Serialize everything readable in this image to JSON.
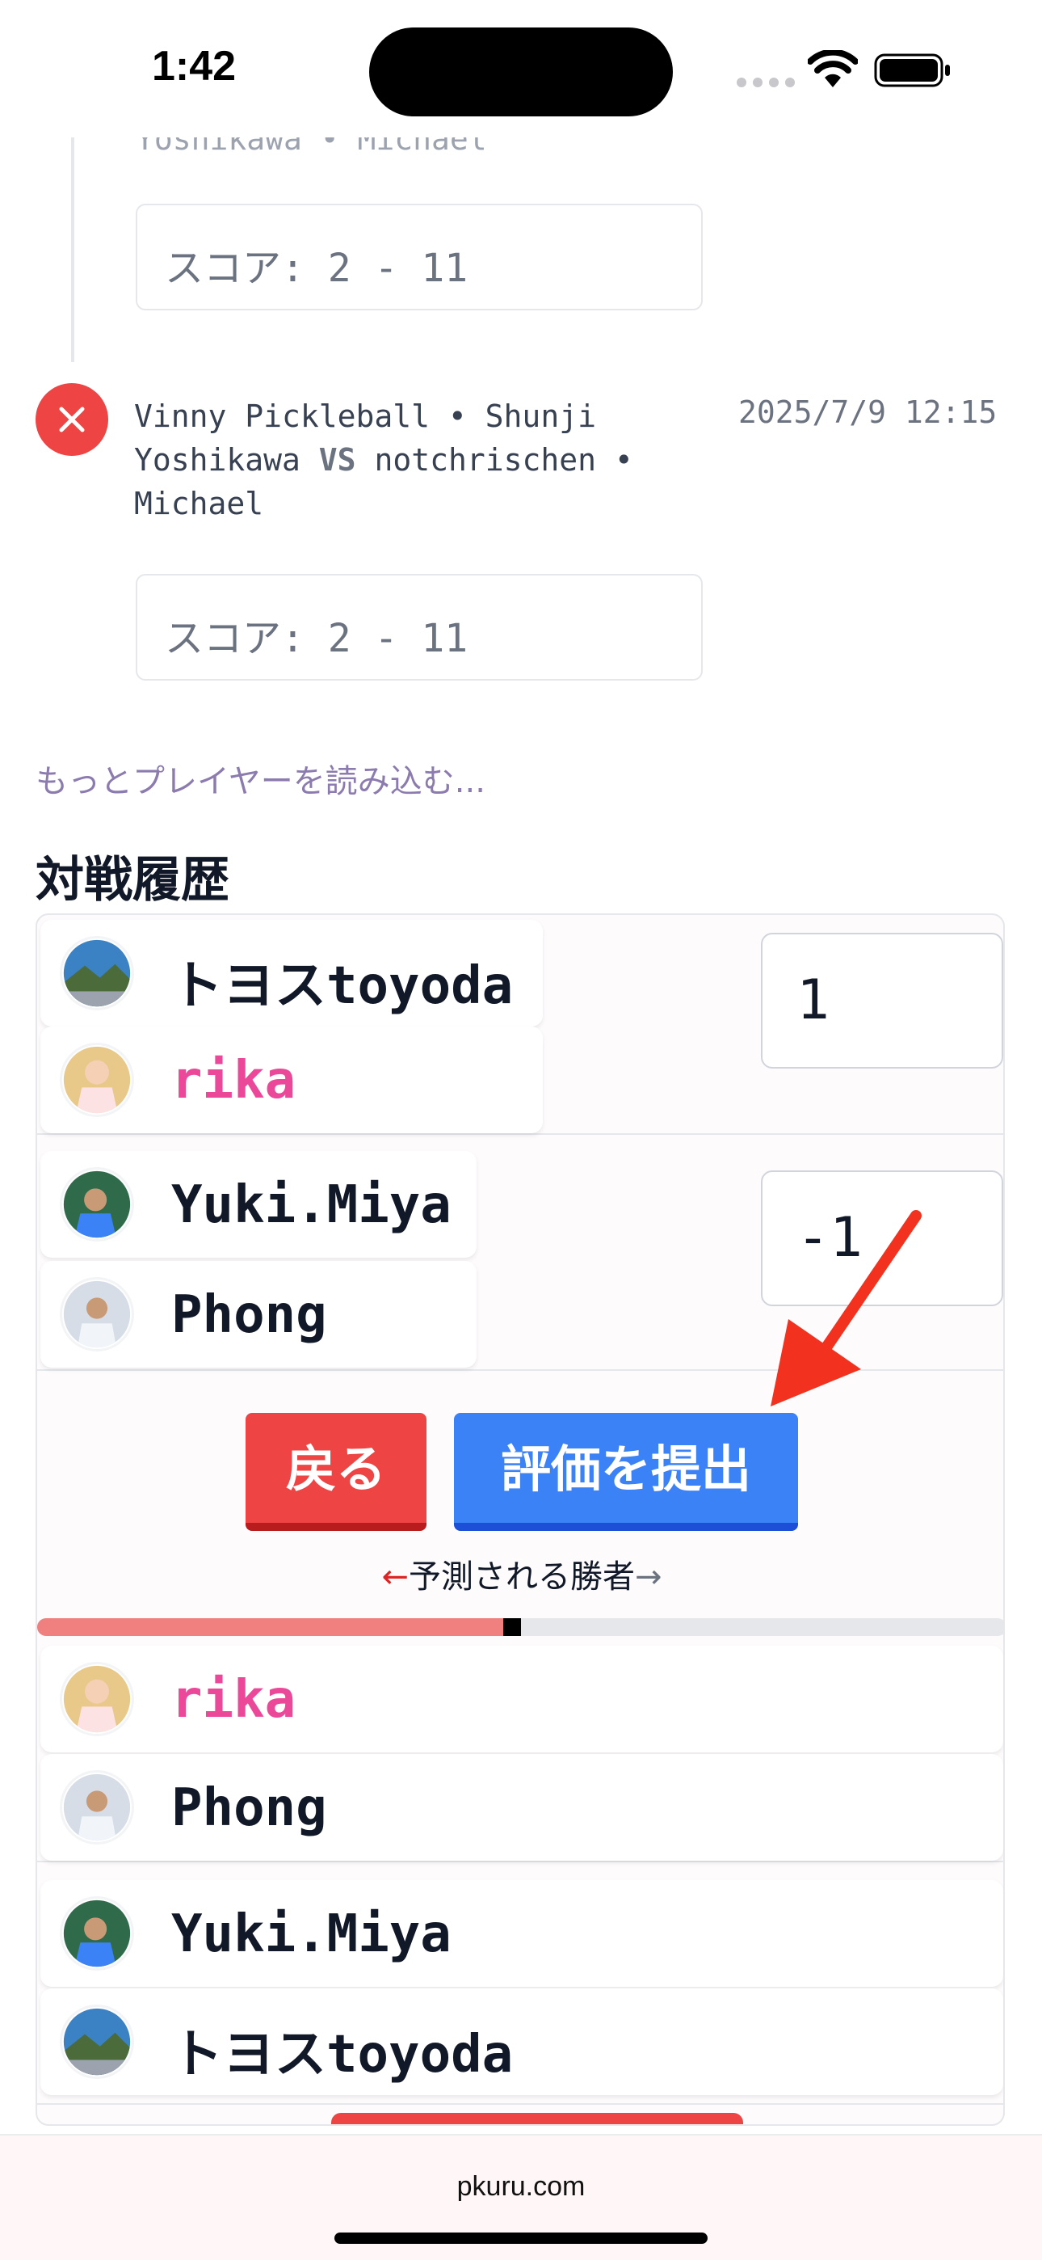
{
  "status_bar": {
    "time": "1:42"
  },
  "feed": {
    "partial_player_line": "Yoshikawa • Michael",
    "score_prev": "スコア: 2 - 11",
    "match": {
      "players_left": "Vinny Pickleball • Shunji Yoshikawa",
      "vs": "VS",
      "players_right": "notchrischen • Michael",
      "timestamp": "2025/7/9 12:15",
      "score": "スコア: 2 - 11"
    },
    "load_more": "もっとプレイヤーを読み込む..."
  },
  "history": {
    "title": "対戦履歴",
    "team_a": {
      "player1": "トヨスtoyoda",
      "player2": "rika",
      "score": "1"
    },
    "team_b": {
      "player1": "Yuki.Miya",
      "player2": "Phong",
      "score": "-1"
    },
    "back_label": "戻る",
    "submit_label": "評価を提出",
    "arrow_left": "←",
    "predicted_label": "予測される勝者",
    "arrow_right": "→",
    "prediction_fraction": 0.49,
    "pair2_player1": "rika",
    "pair2_player2": "Phong",
    "pair3_player1": "Yuki.Miya",
    "pair3_player2": "トヨスtoyoda"
  },
  "browser": {
    "url": "pkuru.com"
  },
  "colors": {
    "accent_red": "#ef4444",
    "accent_blue": "#3b82f6",
    "highlight_pink": "#ec4899",
    "link_purple": "#8b7bae"
  },
  "icons": [
    "wifi-icon",
    "battery-icon",
    "signal-icon",
    "close-icon",
    "annotation-arrow-icon"
  ]
}
